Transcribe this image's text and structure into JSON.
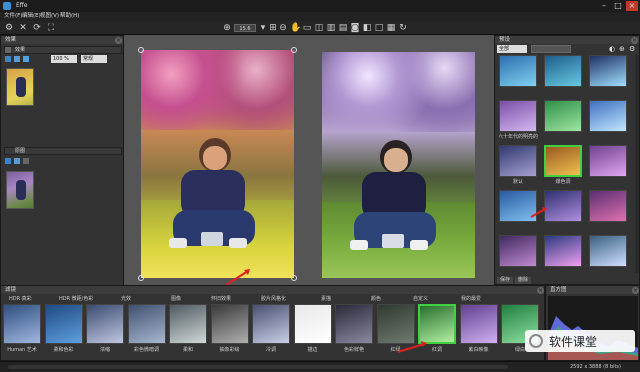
{
  "app": {
    "title": "Effe"
  },
  "menu": [
    "文件(F)",
    "编辑(E)",
    "视图(V)",
    "帮助(H)"
  ],
  "left_panel": {
    "effect_title": "效果",
    "effect_section": "效果",
    "opacity_value": "100 %",
    "blend_mode": "常规",
    "layer_section": "原图"
  },
  "viewer": {
    "zoom_value": "15.6"
  },
  "presets_panel": {
    "title": "预设",
    "filter_value": "全部",
    "labels": [
      "",
      "",
      "",
      "六十年代的明亮的",
      "",
      "",
      "默认",
      "爆色调",
      "",
      "",
      "",
      "",
      "",
      "",
      ""
    ],
    "buttons": [
      "保存",
      "删除"
    ]
  },
  "filmstrip": {
    "title": "滤镜",
    "categories": [
      "HDR 真彩",
      "HDR 微距/色彩",
      "光效",
      "图像",
      "怀旧效果",
      "胶片风格化",
      "素描",
      "颜色",
      "自定义",
      "我的最爱"
    ],
    "labels": [
      "Human 艺术",
      "柔和色彩",
      "浓缩",
      "彩色微暗调",
      "柔和",
      "抽象彩绘",
      "冷调",
      "描边",
      "色彩鲜艳",
      "红绿",
      "红调",
      "紫白映像",
      "绿白"
    ]
  },
  "histogram": {
    "title": "直方图"
  },
  "status": {
    "dimensions": "2592 x 3888 (8 bits)"
  },
  "watermark": {
    "text": "软件课堂"
  }
}
